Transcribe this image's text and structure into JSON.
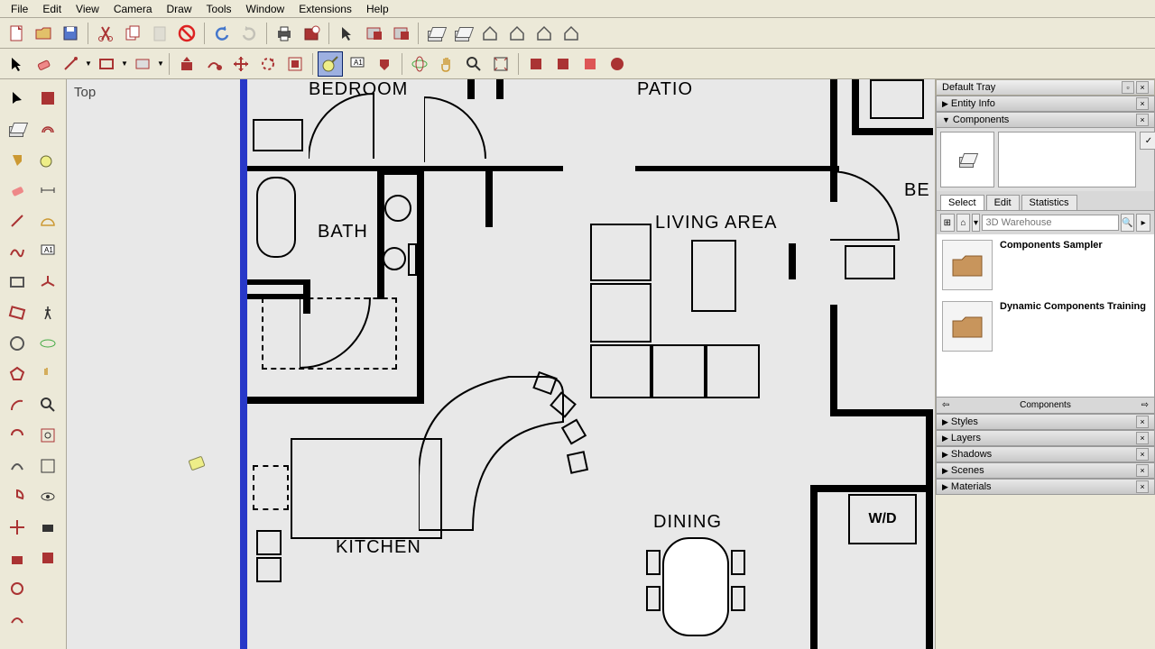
{
  "menu": [
    "File",
    "Edit",
    "View",
    "Camera",
    "Draw",
    "Tools",
    "Window",
    "Extensions",
    "Help"
  ],
  "view_label": "Top",
  "tray": {
    "title": "Default Tray",
    "panels": [
      "Entity Info",
      "Components",
      "Styles",
      "Layers",
      "Shadows",
      "Scenes",
      "Materials"
    ],
    "components": {
      "tabs": [
        "Select",
        "Edit",
        "Statistics"
      ],
      "search_placeholder": "3D Warehouse",
      "list": [
        "Components Sampler",
        "Dynamic Components Training"
      ],
      "footer": "Components"
    }
  },
  "rooms": {
    "bedroom": "BEDROOM",
    "patio": "PATIO",
    "bath": "BATH",
    "living": "LIVING AREA",
    "be": "BE",
    "kitchen": "KITCHEN",
    "dining": "DINING",
    "wd": "W/D"
  },
  "toolbar1": [
    "new-file",
    "open-file",
    "save-file",
    "cut",
    "copy",
    "paste",
    "cancel",
    "undo",
    "redo",
    "print",
    "model-info",
    "select-tool",
    "component1",
    "component2",
    "3d-warehouse1",
    "3d-warehouse2",
    "house1",
    "house2",
    "house3",
    "house4"
  ],
  "toolbar2": [
    "select",
    "eraser",
    "line",
    "rectangle",
    "push-pull",
    "follow-me",
    "move",
    "rotate",
    "scale",
    "tape-measure",
    "text",
    "dimension",
    "paint",
    "orbit",
    "pan",
    "zoom",
    "zoom-extents",
    "section",
    "delete-guides",
    "extension1",
    "extension2"
  ],
  "left_tools": [
    "select",
    "make-component",
    "paint-bucket",
    "eraser2",
    "line2",
    "freehand",
    "rectangle2",
    "rotated-rect",
    "circle",
    "polygon",
    "arc",
    "2pt-arc",
    "3pt-arc",
    "pie",
    "move2",
    "push-pull2",
    "rotate2",
    "follow-me2",
    "scale2",
    "offset",
    "tape",
    "dimension2",
    "protractor",
    "text2",
    "axes",
    "walk",
    "orbit2",
    "pan2",
    "zoom2",
    "zoom-window",
    "zoom-extents2",
    "look-around",
    "position-camera",
    "section2"
  ],
  "colors": {
    "wall": "#000000",
    "canvas": "#e8e8e8",
    "highlight": "#2838c8"
  }
}
